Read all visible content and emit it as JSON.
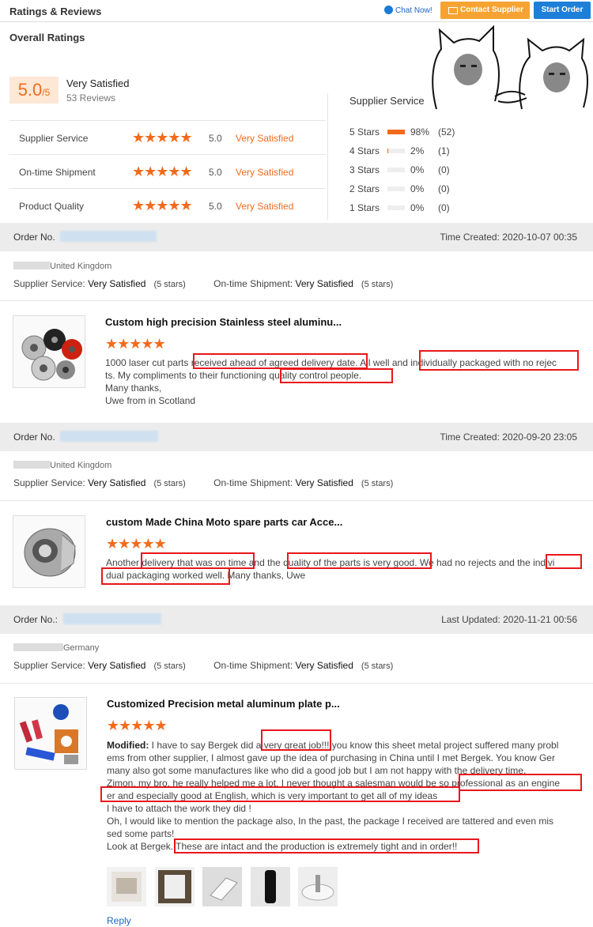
{
  "header": {
    "title": "Ratings & Reviews",
    "chat_now": "Chat Now!",
    "contact_supplier": "Contact Supplier",
    "start_order": "Start Order"
  },
  "overall": {
    "title": "Overall Ratings",
    "score": "5.0",
    "score_max": "/5",
    "summary": "Very Satisfied",
    "reviews_count": "53 Reviews",
    "rows": [
      {
        "label": "Supplier Service",
        "stars": 5,
        "value": "5.0",
        "text": "Very Satisfied"
      },
      {
        "label": "On-time Shipment",
        "stars": 5,
        "value": "5.0",
        "text": "Very Satisfied"
      },
      {
        "label": "Product Quality",
        "stars": 5,
        "value": "5.0",
        "text": "Very Satisfied"
      }
    ]
  },
  "supplier_service": {
    "title": "Supplier Service",
    "distribution": [
      {
        "label": "5 Stars",
        "percent": "98%",
        "count": "(52)",
        "fill": 0.98
      },
      {
        "label": "4 Stars",
        "percent": "2%",
        "count": "(1)",
        "fill": 0.02
      },
      {
        "label": "3 Stars",
        "percent": "0%",
        "count": "(0)",
        "fill": 0
      },
      {
        "label": "2 Stars",
        "percent": "0%",
        "count": "(0)",
        "fill": 0
      },
      {
        "label": "1 Stars",
        "percent": "0%",
        "count": "(0)",
        "fill": 0
      }
    ]
  },
  "labels": {
    "supplier_service": "Supplier Service:",
    "on_time_shipment": "On-time Shipment:",
    "very_satisfied": "Very Satisfied",
    "five_stars": "(5 stars)",
    "reply": "Reply",
    "modified": "Modified:"
  },
  "reviews": [
    {
      "order_label": "Order No.",
      "time_label": "Time Created: 2020-10-07 00:35",
      "country": "United Kingdom",
      "product_title": "Custom high precision Stainless steel aluminu...",
      "text": "1000 laser cut parts received ahead of agreed delivery date. All well and individually packaged with no rejec\nts.  My compliments to their functioning quality control people.\nMany thanks,\nUwe from in Scotland"
    },
    {
      "order_label": "Order No.",
      "time_label": "Time Created: 2020-09-20 23:05",
      "country": "United Kingdom",
      "product_title": "custom Made China Moto spare parts car Acce...",
      "text": "Another delivery that was on time and the quality of the parts is very good. We had no rejects and the indivi\ndual packaging worked well. Many thanks, Uwe"
    },
    {
      "order_label": "Order No.:",
      "time_label": "Last Updated: 2020-11-21 00:56",
      "country": "Germany",
      "product_title": "Customized Precision metal aluminum plate p...",
      "text_first": " I have to say Bergek did a very great job!!! you know this sheet metal project suffered many probl",
      "text_rest": "ems from other supplier, I almost gave up the idea of purchasing in China until I met Bergek.  You know Ger\nmany also got some manufactures like who did a good job but I am not happy with the delivery time.\nZimon, my bro, he really helped me a lot, I never thought a salesman would be so professional as an engine\ner and especially good at English, which is very important to get all of my ideas\nI have to attach the work they did !\nOh, I would like to mention the package also,  In the past,  the package I received are tattered and even mis\nsed some parts!\nLook at Bergek.  These are intact and the production is extremely tight and in order!!"
    }
  ],
  "colors": {
    "accent": "#f26b1d",
    "contact_button": "#f7a332",
    "start_button": "#1e7fd8",
    "highlight": "#e8171b"
  }
}
